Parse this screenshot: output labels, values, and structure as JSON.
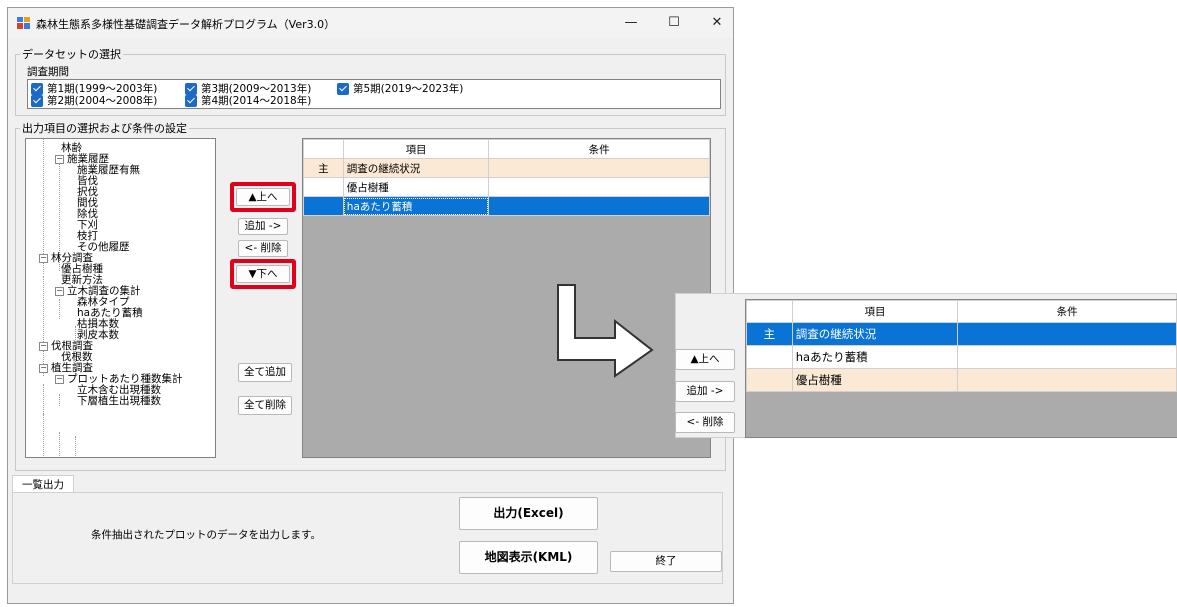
{
  "window": {
    "title": "森林生態系多様性基礎調査データ解析プログラム（Ver3.0）",
    "minimize": "—",
    "maximize": "☐",
    "close": "✕"
  },
  "dataset": {
    "legend": "データセットの選択",
    "period_label": "調査期間",
    "periods": [
      {
        "label": "第1期(1999～2003年)",
        "checked": true
      },
      {
        "label": "第2期(2004～2008年)",
        "checked": true
      },
      {
        "label": "第3期(2009～2013年)",
        "checked": true
      },
      {
        "label": "第4期(2014～2018年)",
        "checked": true
      },
      {
        "label": "第5期(2019～2023年)",
        "checked": true
      }
    ]
  },
  "output_selection": {
    "legend": "出力項目の選択および条件の設定",
    "tree": [
      "林齢",
      "施業履歴",
      "施業履歴有無",
      "皆伐",
      "択伐",
      "間伐",
      "除伐",
      "下刈",
      "枝打",
      "その他履歴",
      "林分調査",
      "優占樹種",
      "更新方法",
      "立木調査の集計",
      "森林タイプ",
      "haあたり蓄積",
      "枯損本数",
      "剥皮本数",
      "伐根調査",
      "伐根数",
      "植生調査",
      "プロットあたり種数集計",
      "立木含む出現種数",
      "下層植生出現種数"
    ],
    "tree_expanders": [
      "−",
      "−",
      "−",
      "−",
      "−",
      "−"
    ],
    "buttons": {
      "up": "▲上へ",
      "add": "追加 ->",
      "remove": "<- 削除",
      "down": "▼下へ",
      "add_all": "全て追加",
      "remove_all": "全て削除"
    },
    "grid": {
      "columns": [
        "項目",
        "条件"
      ],
      "rows": [
        {
          "header": "主",
          "item": "調査の継続状況",
          "condition": ""
        },
        {
          "header": "",
          "item": "優占樹種",
          "condition": ""
        },
        {
          "header": "",
          "item": "haあたり蓄積",
          "condition": ""
        }
      ]
    }
  },
  "list_output": {
    "tab": "一覧出力",
    "description": "条件抽出されたプロットのデータを出力します。",
    "export_excel": "出力(Excel)",
    "map_kml": "地図表示(KML)",
    "exit": "終了"
  },
  "zoom_view": {
    "buttons": {
      "up": "▲上へ",
      "add": "追加 ->",
      "remove": "<- 削除"
    },
    "grid": {
      "columns": [
        "項目",
        "条件"
      ],
      "rows": [
        {
          "header": "主",
          "item": "調査の継続状況",
          "condition": ""
        },
        {
          "header": "",
          "item": "haあたり蓄積",
          "condition": ""
        },
        {
          "header": "",
          "item": "優占樹種",
          "condition": ""
        }
      ]
    }
  },
  "colors": {
    "highlight_red": "#e0001a",
    "selection_blue": "#0a73d6",
    "peach_row": "#fbe9d5",
    "checkbox_blue": "#1b6ac9"
  }
}
